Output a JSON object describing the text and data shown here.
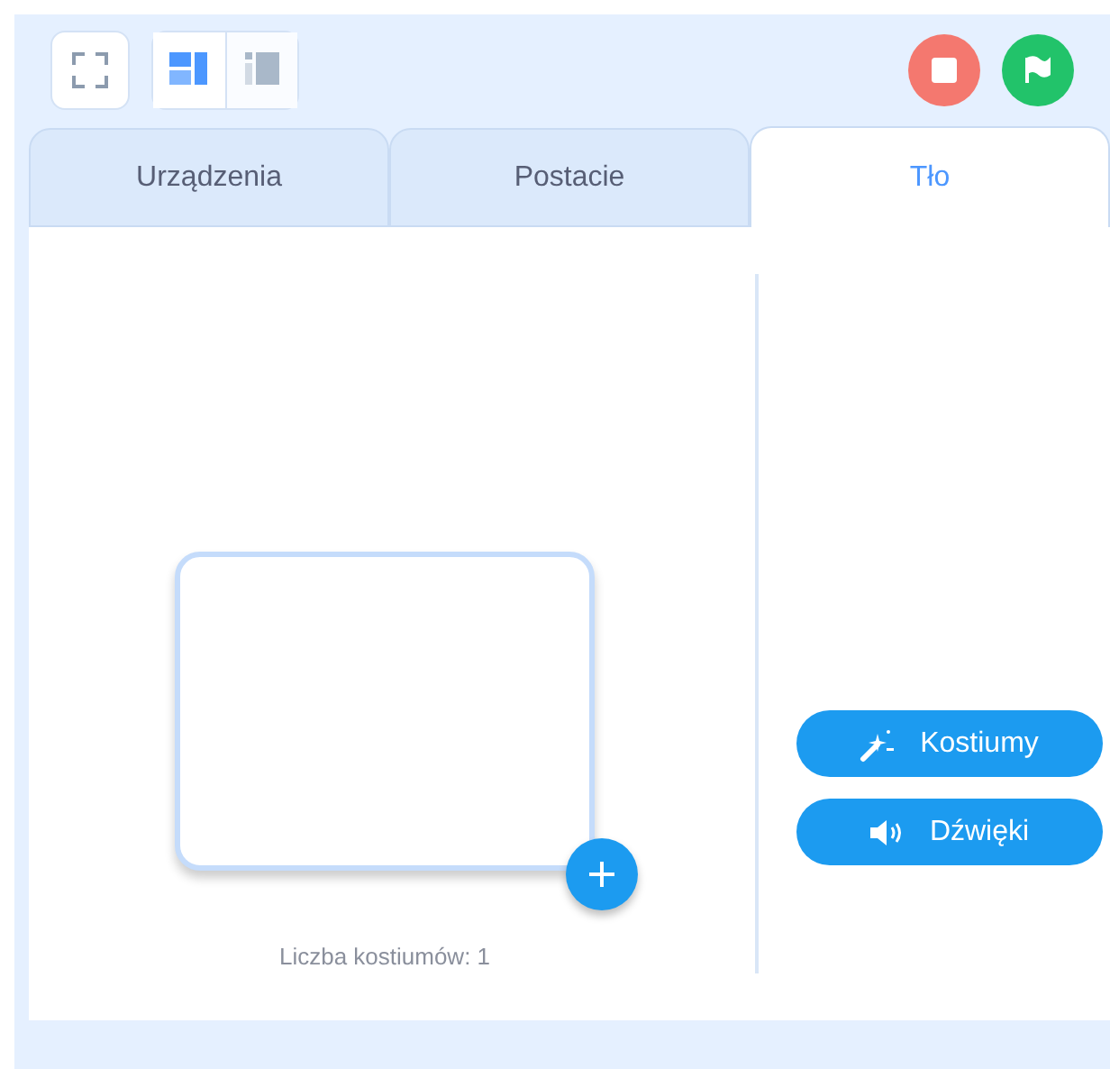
{
  "layout_modes": [
    {
      "kind": "large",
      "selected": true
    },
    {
      "kind": "small",
      "selected": false
    }
  ],
  "tabs": [
    {
      "label": "Urządzenia",
      "selected": false
    },
    {
      "label": "Postacie",
      "selected": false
    },
    {
      "label": "Tło",
      "selected": true
    }
  ],
  "backdrop": {
    "count_label": "Liczba kostiumów: 1"
  },
  "side_buttons": [
    {
      "kind": "costumes",
      "label": "Kostiumy"
    },
    {
      "kind": "sounds",
      "label": "Dźwięki"
    }
  ]
}
